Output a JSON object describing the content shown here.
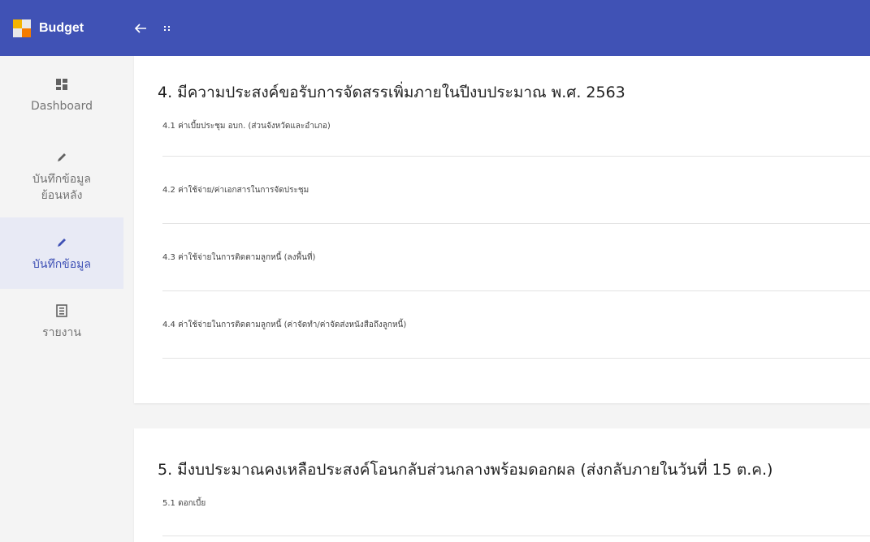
{
  "header": {
    "app_title": "Budget",
    "back_icon": "arrow-left-icon",
    "menu_icon": "grip-icon",
    "bar_color": "#4052b5"
  },
  "sidebar": {
    "items": [
      {
        "label": "Dashboard",
        "icon": "dashboard-icon",
        "active": false
      },
      {
        "label": "บันทึกข้อมูลย้อนหลัง",
        "label_line1": "บันทึกข้อมูล",
        "label_line2": "ย้อนหลัง",
        "icon": "pencil-icon",
        "active": false
      },
      {
        "label": "บันทึกข้อมูล",
        "icon": "pencil-icon",
        "active": true
      },
      {
        "label": "รายงาน",
        "icon": "report-icon",
        "active": false
      }
    ],
    "active_color": "#3f51b5"
  },
  "sections": [
    {
      "title": "4. มีความประสงค์ขอรับการจัดสรรเพิ่มภายในปีงบประมาณ พ.ศ. 2563",
      "items": [
        "4.1 ค่าเบี้ยประชุม อบก. (ส่วนจังหวัดและอำเภอ)",
        "4.2 ค่าใช้จ่าย/ค่าเอกสารในการจัดประชุม",
        "4.3 ค่าใช้จ่ายในการติดตามลูกหนี้ (ลงพื้นที่)",
        "4.4 ค่าใช้จ่ายในการติดตามลูกหนี้ (ค่าจัดทำ/ค่าจัดส่งหนังสือถึงลูกหนี้)"
      ]
    },
    {
      "title": "5. มีงบประมาณคงเหลือประสงค์โอนกลับส่วนกลางพร้อมดอกผล (ส่งกลับภายในวันที่ 15 ต.ค.)",
      "items": [
        "5.1 ดอกเบี้ย"
      ]
    }
  ]
}
